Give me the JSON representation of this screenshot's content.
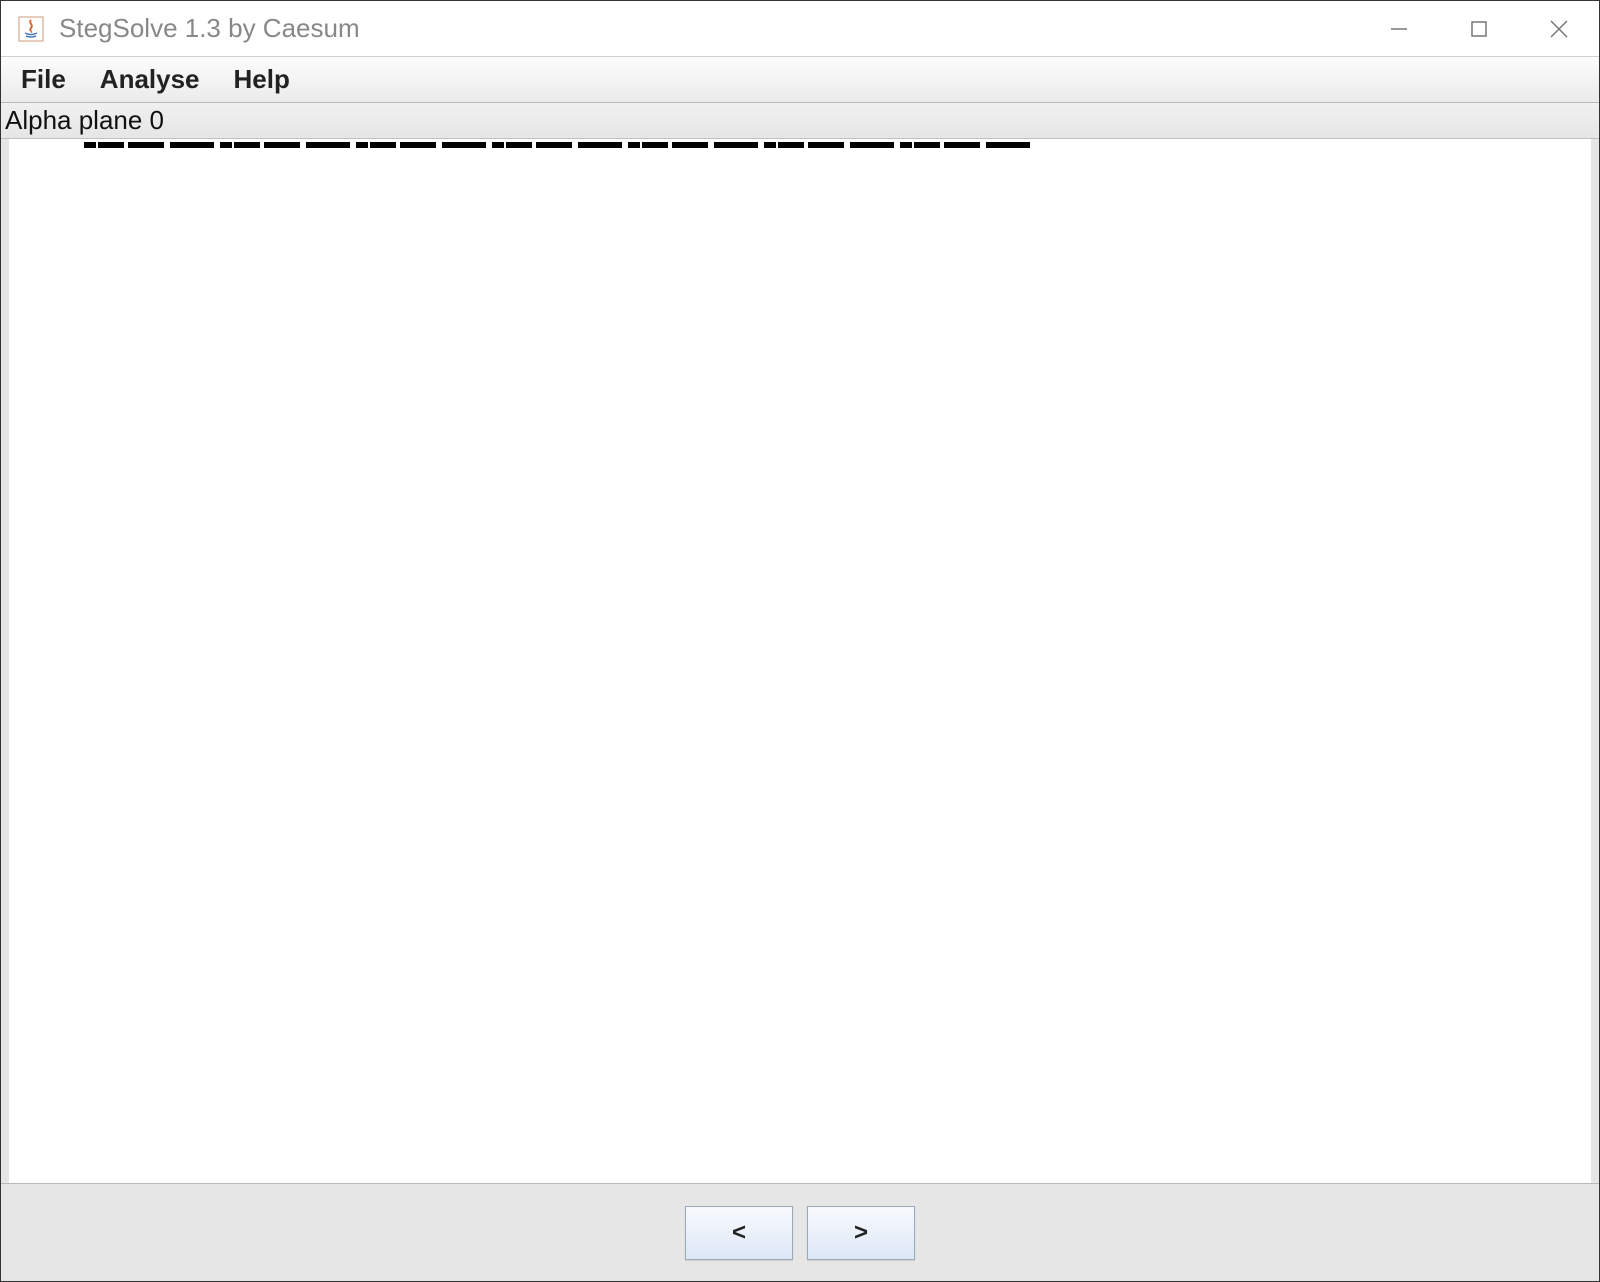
{
  "titlebar": {
    "app_title": "StegSolve 1.3 by Caesum"
  },
  "menubar": {
    "items": [
      "File",
      "Analyse",
      "Help"
    ]
  },
  "status": {
    "current_plane": "Alpha plane 0"
  },
  "nav": {
    "prev_label": "<",
    "next_label": ">"
  }
}
